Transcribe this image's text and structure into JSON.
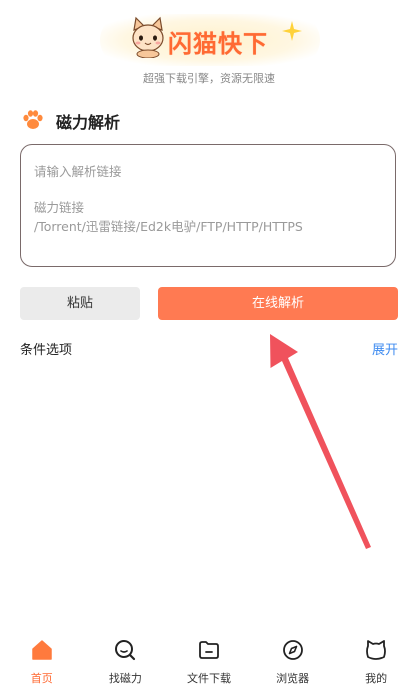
{
  "header": {
    "app_title": "闪猫快下",
    "subtitle": "超强下载引擎，资源无限速"
  },
  "section": {
    "title": "磁力解析"
  },
  "input": {
    "placeholder": "请输入解析链接",
    "hint_line1": "磁力链接",
    "hint_line2": "/Torrent/迅雷链接/Ed2k电驴/FTP/HTTP/HTTPS"
  },
  "buttons": {
    "paste": "粘贴",
    "parse": "在线解析"
  },
  "conditions": {
    "label": "条件选项",
    "expand": "展开"
  },
  "tabbar": {
    "items": [
      {
        "label": "首页",
        "icon": "home-icon",
        "active": true
      },
      {
        "label": "找磁力",
        "icon": "search-icon",
        "active": false
      },
      {
        "label": "文件下载",
        "icon": "folder-icon",
        "active": false
      },
      {
        "label": "浏览器",
        "icon": "compass-icon",
        "active": false
      },
      {
        "label": "我的",
        "icon": "cat-face-icon",
        "active": false
      }
    ]
  },
  "colors": {
    "accent": "#ff6a33",
    "button_primary": "#ff7a52",
    "link": "#3e8bf0",
    "annotation_arrow": "#f0525c"
  }
}
